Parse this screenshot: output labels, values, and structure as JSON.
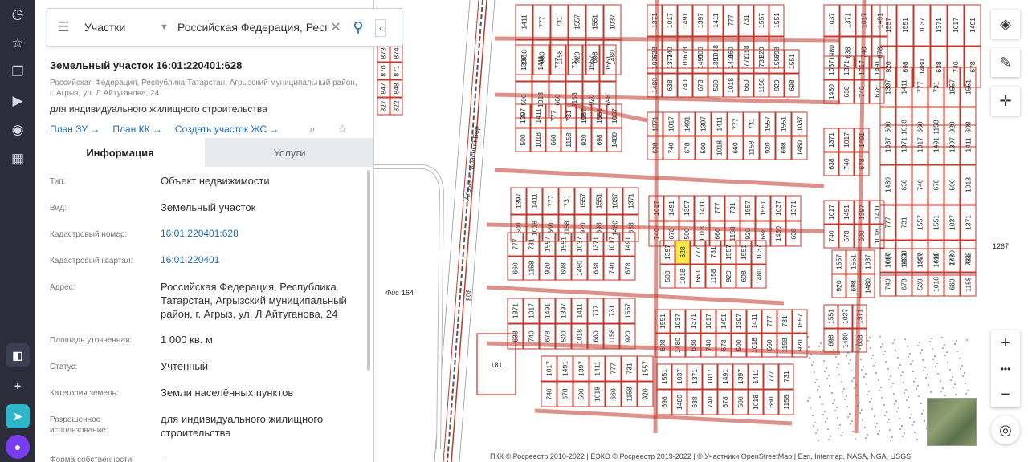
{
  "search": {
    "type_label": "Участки",
    "query_value": "Российская Федерация, Респу"
  },
  "parcel": {
    "title": "Земельный участок 16:01:220401:628",
    "address_short": "Российская Федерация, Республика Татарстан, Агрызский муниципальный район, г. Агрыз, ул. Л Айтуганова, 24",
    "purpose": "для индивидуального жилищного строительства",
    "links": [
      "План ЗУ →",
      "План КК →",
      "Создать участок ЖС →"
    ]
  },
  "tabs": [
    {
      "label": "Информация",
      "active": true
    },
    {
      "label": "Услуги",
      "active": false
    }
  ],
  "info_rows": [
    {
      "label": "Тип:",
      "value": "Объект недвижимости",
      "link": false
    },
    {
      "label": "Вид:",
      "value": "Земельный участок",
      "link": false
    },
    {
      "label": "Кадастровый номер:",
      "value": "16:01:220401:628",
      "link": true
    },
    {
      "label": "Кадастровый квартал:",
      "value": "16:01:220401",
      "link": true
    },
    {
      "label": "Адрес:",
      "value": "Российская Федерация, Республика Татарстан, Агрызский муниципальный район, г. Агрыз, ул. Л Айтуганова, 24",
      "link": false
    },
    {
      "label": "Площадь уточненная:",
      "value": "1 000 кв. м",
      "link": false
    },
    {
      "label": "Статус:",
      "value": "Учтенный",
      "link": false
    },
    {
      "label": "Категория земель:",
      "value": "Земли населённых пунктов",
      "link": false
    },
    {
      "label": "Разрешенное использование:",
      "value": "для индивидуального жилищного строительства",
      "link": false
    },
    {
      "label": "Форма собственности:",
      "value": "-",
      "link": false
    }
  ],
  "map": {
    "road_label": "Агрыз — Красный Бор",
    "road_number": "303",
    "highlight_parcel": "628",
    "other_labels": [
      "181",
      "164",
      "1267"
    ],
    "street_fragment": "Фис",
    "attribution": "ПКК © Росреестр 2010-2022 | ЕЭКО © Росреестр 2019-2022 | © Участники OpenStreetMap | Esri, Intermap, NASA, NGA, USGS"
  },
  "map_controls": {
    "zoom_in": "+",
    "zoom_more": "•••",
    "zoom_out": "−"
  },
  "colors": {
    "accent": "#1e6cb6",
    "parcel_line": "#c0392b",
    "highlight": "#f5e94a"
  }
}
